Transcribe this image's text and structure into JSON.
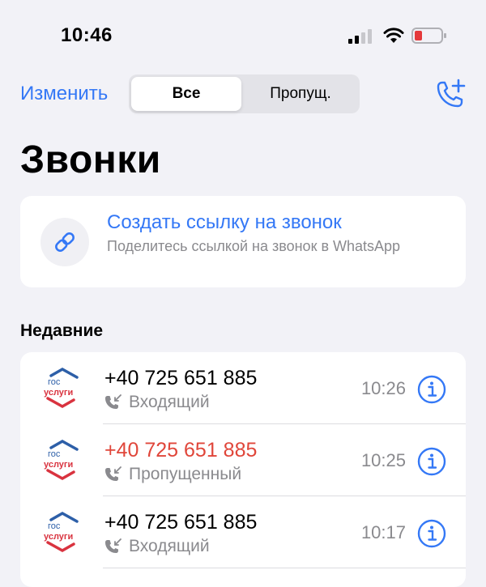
{
  "status_bar": {
    "time": "10:46",
    "icons": [
      "cellular-signal-icon",
      "wifi-icon",
      "battery-low-icon"
    ],
    "battery_color": "#e5393b"
  },
  "nav": {
    "edit_label": "Изменить",
    "segments": [
      {
        "label": "Все",
        "selected": true
      },
      {
        "label": "Пропущ.",
        "selected": false
      }
    ],
    "new_call_icon": "phone-plus-icon"
  },
  "title": "Звонки",
  "call_link": {
    "icon": "link-icon",
    "title": "Создать ссылку на звонок",
    "description": "Поделитесь ссылкой на звонок в WhatsApp"
  },
  "recent": {
    "header": "Недавние",
    "calls": [
      {
        "avatar": "gosuslugi-logo",
        "avatar_text_top": "гос",
        "avatar_text_bottom": "услуги",
        "number": "+40 725 651 885",
        "type": "Входящий",
        "type_icon": "incoming-call-icon",
        "missed": false,
        "time": "10:26"
      },
      {
        "avatar": "gosuslugi-logo",
        "avatar_text_top": "гос",
        "avatar_text_bottom": "услуги",
        "number": "+40 725 651 885",
        "type": "Пропущенный",
        "type_icon": "incoming-call-icon",
        "missed": true,
        "time": "10:25"
      },
      {
        "avatar": "gosuslugi-logo",
        "avatar_text_top": "гос",
        "avatar_text_bottom": "услуги",
        "number": "+40 725 651 885",
        "type": "Входящий",
        "type_icon": "incoming-call-icon",
        "missed": false,
        "time": "10:17"
      }
    ]
  },
  "colors": {
    "accent": "#3478f6",
    "missed": "#e0463a",
    "secondary_text": "#8a8a8e"
  }
}
